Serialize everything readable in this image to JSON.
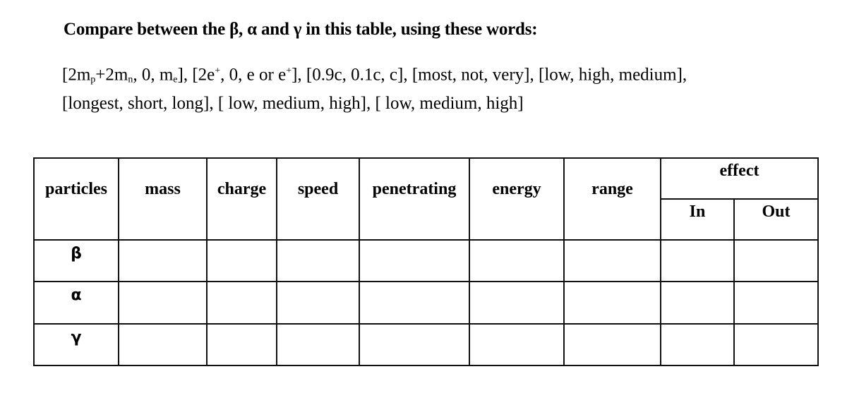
{
  "title": "Compare between the  β, α and γ in this table, using these words:",
  "word_groups_line1": [
    {
      "parts": [
        "[2m",
        "p",
        "+2m",
        "n",
        ", 0, m",
        "e",
        "]"
      ]
    },
    {
      "text": "[2e⁺, 0, e or e⁺]"
    },
    {
      "text": "[0.9c, 0.1c, c]"
    },
    {
      "text": "[most, not, very]"
    },
    {
      "text": "[low, high, medium],"
    }
  ],
  "words_line1_text": "[2mp+2mn, 0, me], [2e+, 0, e or e+], [0.9c, 0.1c, c], [most, not, very], [low, high, medium],",
  "words_line2_text": "[longest, short, long],  [ low, medium, high], [ low, medium, high]",
  "table": {
    "headers": {
      "particles": "particles",
      "mass": "mass",
      "charge": "charge",
      "speed": "speed",
      "penetrating": "penetrating",
      "energy": "energy",
      "range": "range",
      "effect": "effect",
      "effect_in": "In",
      "effect_out": "Out"
    },
    "rows": [
      {
        "particle": "β",
        "mass": "",
        "charge": "",
        "speed": "",
        "penetrating": "",
        "energy": "",
        "range": "",
        "in": "",
        "out": ""
      },
      {
        "particle": "α",
        "mass": "",
        "charge": "",
        "speed": "",
        "penetrating": "",
        "energy": "",
        "range": "",
        "in": "",
        "out": ""
      },
      {
        "particle": "γ",
        "mass": "",
        "charge": "",
        "speed": "",
        "penetrating": "",
        "energy": "",
        "range": "",
        "in": "",
        "out": ""
      }
    ]
  }
}
